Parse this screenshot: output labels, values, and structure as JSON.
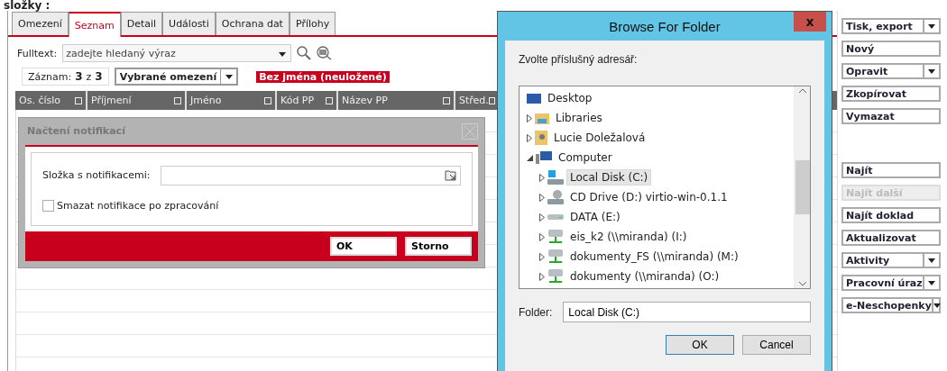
{
  "heading": "složky :",
  "tabs": [
    {
      "label": "Omezení",
      "selected": false
    },
    {
      "label": "Seznam",
      "selected": true
    },
    {
      "label": "Detail",
      "selected": false
    },
    {
      "label": "Události",
      "selected": false
    },
    {
      "label": "Ochrana dat",
      "selected": false
    },
    {
      "label": "Přílohy",
      "selected": false
    }
  ],
  "fulltext": {
    "label": "Fulltext:",
    "placeholder": "zadejte hledaný výraz"
  },
  "record": {
    "label": "Záznam:",
    "current": "3",
    "sep": "z",
    "total": "3"
  },
  "filter": {
    "value": "Vybrané omezení",
    "tag": "Bez jména (neuložené)"
  },
  "table": {
    "columns": [
      "Os. číslo",
      "Příjmení",
      "Jméno",
      "Kód PP",
      "Název PP",
      "Střed."
    ]
  },
  "notify_dialog": {
    "title": "Načtení notifikací",
    "field_label": "Složka s notifikacemi:",
    "checkbox": {
      "label": "Smazat notifikace po zpracování",
      "checked": false
    },
    "buttons": [
      "OK",
      "Storno"
    ]
  },
  "browse_dialog": {
    "title": "Browse For Folder",
    "close": "x",
    "prompt": "Zvolte příslušný adresář:",
    "tree": [
      {
        "label": "Desktop",
        "kind": "desktop",
        "selected": false,
        "children": [
          {
            "label": "Libraries",
            "kind": "library",
            "selected": false,
            "expanded": false
          },
          {
            "label": "Lucie Doležalová",
            "kind": "user",
            "selected": false,
            "expanded": false
          },
          {
            "label": "Computer",
            "kind": "computer",
            "selected": false,
            "expanded": true,
            "children": [
              {
                "label": "Local Disk (C:)",
                "kind": "disk",
                "selected": true,
                "expanded": false
              },
              {
                "label": "CD Drive (D:) virtio-win-0.1.1",
                "kind": "cd",
                "selected": false,
                "expanded": false
              },
              {
                "label": "DATA (E:)",
                "kind": "drive",
                "selected": false,
                "expanded": false
              },
              {
                "label": "eis_k2 (\\\\miranda) (I:)",
                "kind": "network",
                "selected": false,
                "expanded": false
              },
              {
                "label": "dokumenty_FS (\\\\miranda) (M:)",
                "kind": "network",
                "selected": false,
                "expanded": false
              },
              {
                "label": "dokumenty (\\\\miranda) (O:)",
                "kind": "network",
                "selected": false,
                "expanded": false
              }
            ]
          }
        ]
      }
    ],
    "folder_label": "Folder:",
    "folder_value": "Local Disk (C:)",
    "buttons": [
      "OK",
      "Cancel"
    ]
  },
  "actions": [
    {
      "label": "Tisk, export",
      "dropdown": true,
      "disabled": false,
      "gap_before": false
    },
    {
      "label": "Nový",
      "dropdown": false,
      "disabled": false,
      "gap_before": false
    },
    {
      "label": "Opravit",
      "dropdown": true,
      "disabled": false,
      "gap_before": false
    },
    {
      "label": "Zkopírovat",
      "dropdown": false,
      "disabled": false,
      "gap_before": false
    },
    {
      "label": "Vymazat",
      "dropdown": false,
      "disabled": false,
      "gap_before": false
    },
    {
      "label": "Najít",
      "dropdown": false,
      "disabled": false,
      "gap_before": true
    },
    {
      "label": "Najít další",
      "dropdown": false,
      "disabled": true,
      "gap_before": false
    },
    {
      "label": "Najít doklad",
      "dropdown": false,
      "disabled": false,
      "gap_before": false
    },
    {
      "label": "Aktualizovat",
      "dropdown": false,
      "disabled": false,
      "gap_before": false
    },
    {
      "label": "Aktivity",
      "dropdown": true,
      "disabled": false,
      "gap_before": false
    },
    {
      "label": "Pracovní úraz",
      "dropdown": true,
      "disabled": false,
      "gap_before": false
    },
    {
      "label": "e-Neschopenky",
      "dropdown": true,
      "disabled": false,
      "gap_before": false
    }
  ]
}
